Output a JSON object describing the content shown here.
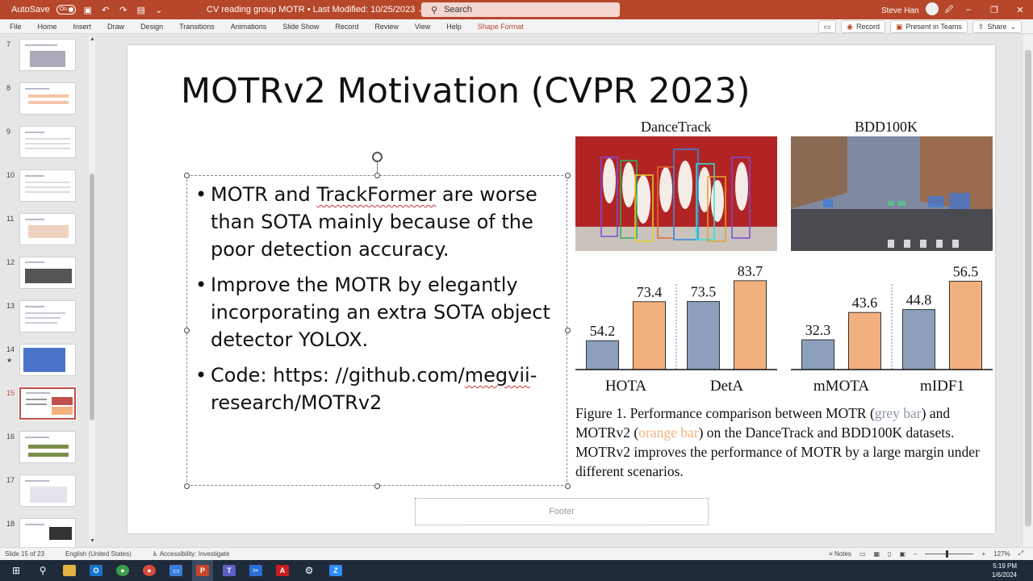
{
  "titlebar": {
    "autosave_label": "AutoSave",
    "autosave_state": "On",
    "document_title": "CV reading group MOTR  •  Last Modified: 10/25/2023  ⌄",
    "search_placeholder": "Search",
    "user_name": "Steve Han",
    "minimize": "–",
    "restore": "❐",
    "close": "✕",
    "ribbon_display": "🖉"
  },
  "ribbon": {
    "tabs": [
      "File",
      "Home",
      "Insert",
      "Draw",
      "Design",
      "Transitions",
      "Animations",
      "Slide Show",
      "Record",
      "Review",
      "View",
      "Help",
      "Shape Format"
    ],
    "comments_icon": "comment-icon",
    "record_button": "Record",
    "present_button": "Present in Teams",
    "share_button": "Share"
  },
  "thumbnails": [
    {
      "num": "7",
      "star": ""
    },
    {
      "num": "8",
      "star": ""
    },
    {
      "num": "9",
      "star": ""
    },
    {
      "num": "10",
      "star": ""
    },
    {
      "num": "11",
      "star": ""
    },
    {
      "num": "12",
      "star": ""
    },
    {
      "num": "13",
      "star": ""
    },
    {
      "num": "14",
      "star": "★"
    },
    {
      "num": "15",
      "star": ""
    },
    {
      "num": "16",
      "star": ""
    },
    {
      "num": "17",
      "star": ""
    },
    {
      "num": "18",
      "star": ""
    }
  ],
  "slide": {
    "title": "MOTRv2 Motivation (CVPR 2023)",
    "bullet1_a": "MOTR and ",
    "bullet1_b": "TrackFormer",
    "bullet1_c": " are worse than SOTA mainly because of the poor detection accuracy.",
    "bullet2": "Improve the MOTR by elegantly incorporating an extra SOTA object detector YOLOX.",
    "bullet3_a": "Code: https: //github.com/",
    "bullet3_b": "megvii",
    "bullet3_c": "-research/MOTRv2",
    "footer": "Footer"
  },
  "figure": {
    "dancetrack_label": "DanceTrack",
    "bdd_label": "BDD100K",
    "caption_a": "Figure 1. Performance comparison between MOTR (",
    "caption_grey": "grey bar",
    "caption_b": ") and MOTRv2 (",
    "caption_orange": "orange bar",
    "caption_c": ") on the DanceTrack and BDD100K datasets. MOTRv2 improves the performance of MOTR by a large margin under different scenarios."
  },
  "chart_data": [
    {
      "type": "bar",
      "categories": [
        "HOTA",
        "DetA"
      ],
      "series": [
        {
          "name": "MOTR",
          "color": "#8c9fbc",
          "values": [
            54.2,
            73.5
          ]
        },
        {
          "name": "MOTRv2",
          "color": "#f3b07f",
          "values": [
            73.4,
            83.7
          ]
        }
      ],
      "title": "DanceTrack",
      "ylim": [
        40,
        90
      ]
    },
    {
      "type": "bar",
      "categories": [
        "mMOTA",
        "mIDF1"
      ],
      "series": [
        {
          "name": "MOTR",
          "color": "#8c9fbc",
          "values": [
            32.3,
            44.8
          ]
        },
        {
          "name": "MOTRv2",
          "color": "#f3b07f",
          "values": [
            43.6,
            56.5
          ]
        }
      ],
      "title": "BDD100K",
      "ylim": [
        20,
        62
      ]
    }
  ],
  "statusbar": {
    "slide_info": "Slide 15 of 23",
    "language": "English (United States)",
    "accessibility": "Accessibility: Investigate",
    "notes": "Notes",
    "zoom": "127%"
  },
  "taskbar": {
    "time": "5:19 PM",
    "date": "1/6/2024"
  }
}
